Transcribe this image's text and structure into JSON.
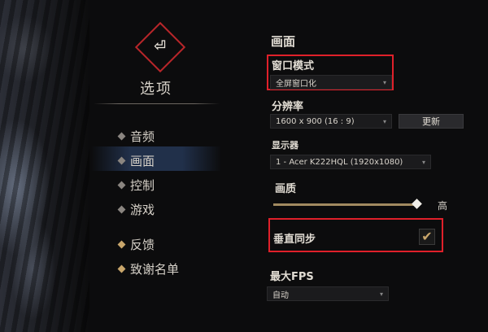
{
  "nav": {
    "back_icon_glyph": "⏎",
    "title": "选项",
    "items": [
      {
        "label": "音频"
      },
      {
        "label": "画面"
      },
      {
        "label": "控制"
      },
      {
        "label": "游戏"
      },
      {
        "label": "反馈"
      },
      {
        "label": "致谢名单"
      }
    ],
    "selected": "画面"
  },
  "panel": {
    "title": "画面",
    "window_mode": {
      "label": "窗口模式",
      "value": "全屏窗口化"
    },
    "resolution": {
      "label": "分辨率",
      "value": "1600 x 900 (16 : 9)",
      "apply_label": "更新"
    },
    "display": {
      "label": "显示器",
      "value": "1 - Acer K222HQL (1920x1080)"
    },
    "quality": {
      "label": "画质",
      "value_label": "高",
      "level": 1.0
    },
    "vsync": {
      "label": "垂直同步",
      "checked": true
    },
    "max_fps": {
      "label": "最大FPS",
      "value": "自动"
    }
  },
  "colors": {
    "highlight_box": "#e0202a",
    "accent_gold": "#c9a66b",
    "selected_bg": "#283c5f"
  }
}
